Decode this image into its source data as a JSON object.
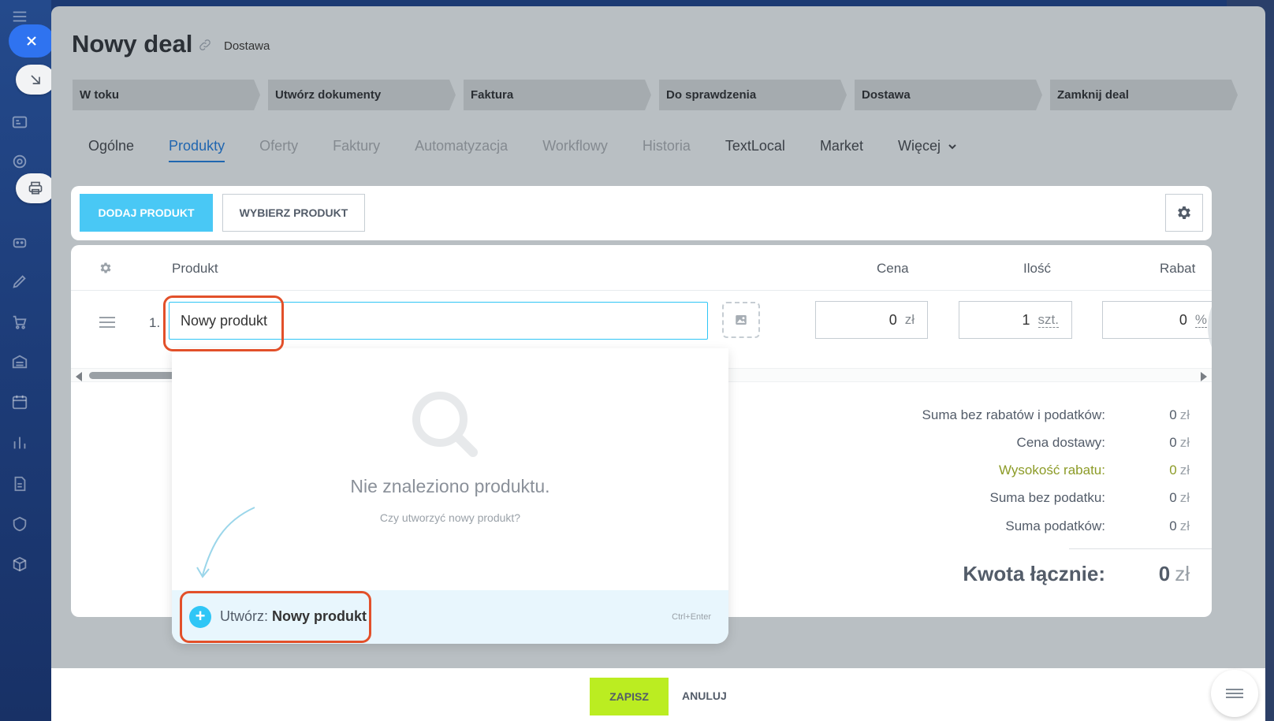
{
  "deal": {
    "title": "Nowy deal",
    "subtitle": "Dostawa"
  },
  "stages": [
    "W toku",
    "Utwórz dokumenty",
    "Faktura",
    "Do sprawdzenia",
    "Dostawa",
    "Zamknij deal"
  ],
  "tabs": [
    {
      "label": "Ogólne",
      "state": "dark"
    },
    {
      "label": "Produkty",
      "state": "active"
    },
    {
      "label": "Oferty",
      "state": "muted"
    },
    {
      "label": "Faktury",
      "state": "muted"
    },
    {
      "label": "Automatyzacja",
      "state": "muted"
    },
    {
      "label": "Workflowy",
      "state": "muted"
    },
    {
      "label": "Historia",
      "state": "muted"
    },
    {
      "label": "TextLocal",
      "state": "dark"
    },
    {
      "label": "Market",
      "state": "dark"
    },
    {
      "label": "Więcej",
      "state": "dark"
    }
  ],
  "toolbar": {
    "add_label": "DODAJ PRODUKT",
    "choose_label": "WYBIERZ PRODUKT"
  },
  "grid": {
    "columns": {
      "product": "Produkt",
      "price": "Cena",
      "qty": "Ilość",
      "discount": "Rabat"
    },
    "row": {
      "number": "1.",
      "product_value": "Nowy produkt",
      "price": "0",
      "price_unit": "zł",
      "qty": "1",
      "qty_unit": "szt.",
      "discount": "0",
      "discount_unit": "%"
    }
  },
  "totals": {
    "items": [
      {
        "label": "Suma bez rabatów i podatków:",
        "value": "0",
        "currency": "zł"
      },
      {
        "label": "Cena dostawy:",
        "value": "0",
        "currency": "zł"
      },
      {
        "label": "Wysokość rabatu:",
        "value": "0",
        "currency": "zł"
      },
      {
        "label": "Suma bez podatku:",
        "value": "0",
        "currency": "zł"
      },
      {
        "label": "Suma podatków:",
        "value": "0",
        "currency": "zł"
      }
    ],
    "total_label": "Kwota łącznie:",
    "total_value": "0",
    "total_currency": "zł"
  },
  "dropdown": {
    "empty_text": "Nie znaleziono produktu.",
    "question": "Czy utworzyć nowy produkt?",
    "create_prefix": "Utwórz:",
    "create_name": "Nowy produkt",
    "shortcut": "Ctrl+Enter"
  },
  "footer": {
    "save_label": "ZAPISZ",
    "cancel_label": "ANULUJ"
  },
  "colors": {
    "accent": "#2fc6f6",
    "save": "#bbed21",
    "highlight": "#e2502a",
    "discount_text": "#8c9b27"
  }
}
